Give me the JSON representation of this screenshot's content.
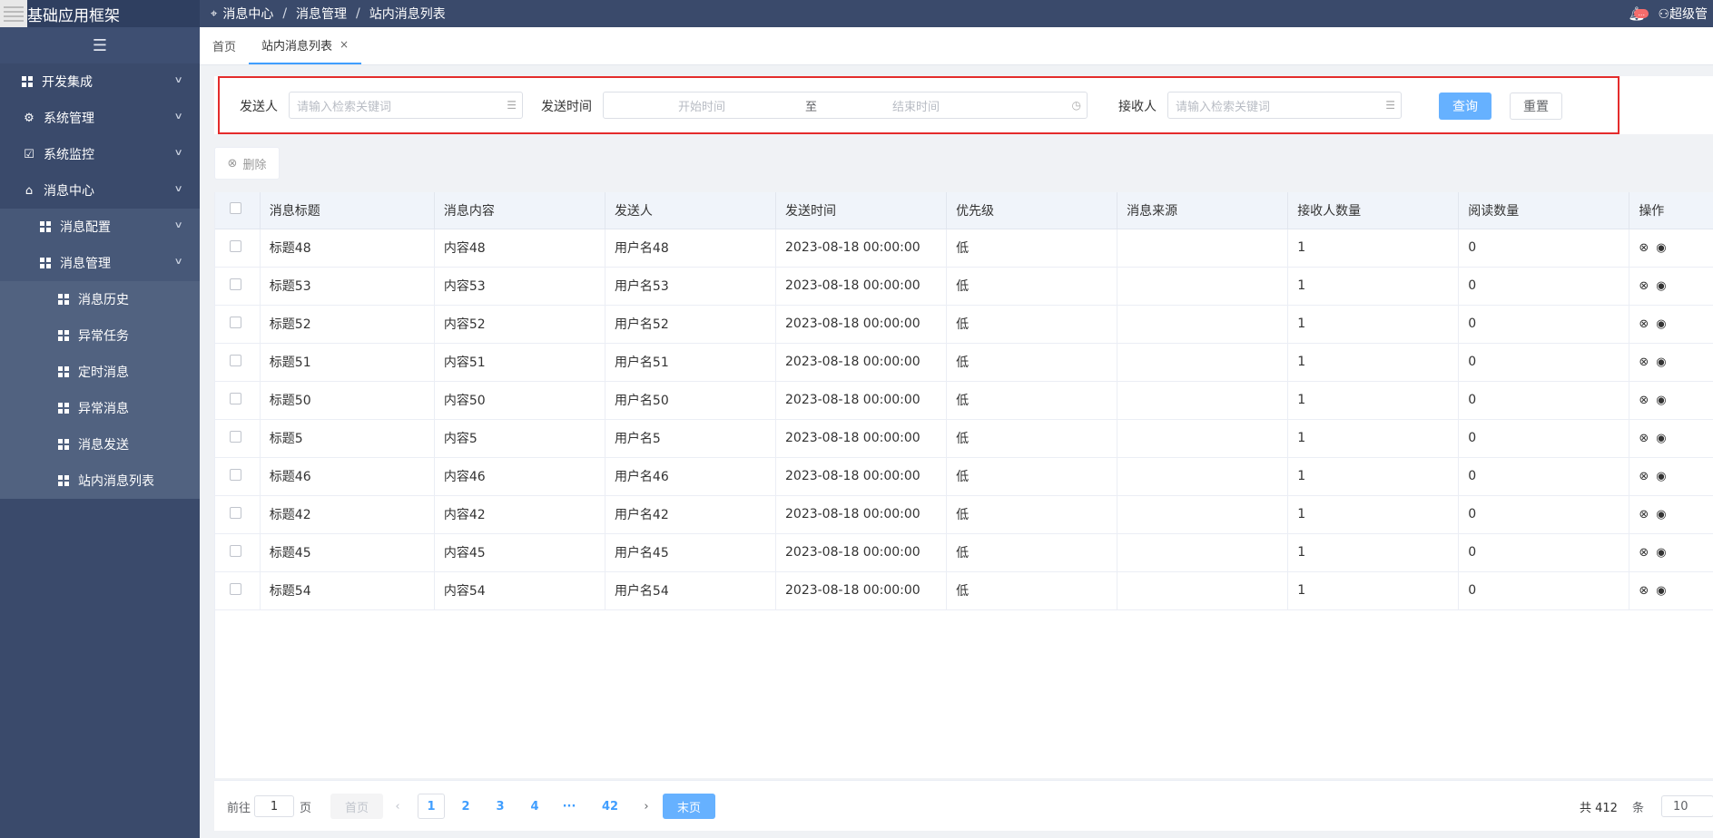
{
  "app": {
    "title": "基础应用框架"
  },
  "sidebar": {
    "items": [
      {
        "label": "开发集成"
      },
      {
        "label": "系统管理"
      },
      {
        "label": "系统监控"
      },
      {
        "label": "消息中心"
      },
      {
        "label": "消息配置"
      },
      {
        "label": "消息管理"
      },
      {
        "label": "消息历史"
      },
      {
        "label": "异常任务"
      },
      {
        "label": "定时消息"
      },
      {
        "label": "异常消息"
      },
      {
        "label": "消息发送"
      },
      {
        "label": "站内消息列表"
      }
    ]
  },
  "header": {
    "breadcrumb": [
      "消息中心",
      "消息管理",
      "站内消息列表"
    ],
    "notify_badge": "...",
    "user": "超级管"
  },
  "tabs": [
    {
      "label": "首页"
    },
    {
      "label": "站内消息列表",
      "close": "×"
    }
  ],
  "search": {
    "sender_label": "发送人",
    "sender_placeholder": "请输入检索关键词",
    "time_label": "发送时间",
    "start_placeholder": "开始时间",
    "to": "至",
    "end_placeholder": "结束时间",
    "receiver_label": "接收人",
    "receiver_placeholder": "请输入检索关键词",
    "query": "查询",
    "reset": "重置"
  },
  "toolbar": {
    "delete": "删除"
  },
  "table": {
    "columns": [
      "消息标题",
      "消息内容",
      "发送人",
      "发送时间",
      "优先级",
      "消息来源",
      "接收人数量",
      "阅读数量",
      "操作"
    ],
    "rows": [
      [
        "标题48",
        "内容48",
        "用户名48",
        "2023-08-18 00:00:00",
        "低",
        "",
        "1",
        "0"
      ],
      [
        "标题53",
        "内容53",
        "用户名53",
        "2023-08-18 00:00:00",
        "低",
        "",
        "1",
        "0"
      ],
      [
        "标题52",
        "内容52",
        "用户名52",
        "2023-08-18 00:00:00",
        "低",
        "",
        "1",
        "0"
      ],
      [
        "标题51",
        "内容51",
        "用户名51",
        "2023-08-18 00:00:00",
        "低",
        "",
        "1",
        "0"
      ],
      [
        "标题50",
        "内容50",
        "用户名50",
        "2023-08-18 00:00:00",
        "低",
        "",
        "1",
        "0"
      ],
      [
        "标题5",
        "内容5",
        "用户名5",
        "2023-08-18 00:00:00",
        "低",
        "",
        "1",
        "0"
      ],
      [
        "标题46",
        "内容46",
        "用户名46",
        "2023-08-18 00:00:00",
        "低",
        "",
        "1",
        "0"
      ],
      [
        "标题42",
        "内容42",
        "用户名42",
        "2023-08-18 00:00:00",
        "低",
        "",
        "1",
        "0"
      ],
      [
        "标题45",
        "内容45",
        "用户名45",
        "2023-08-18 00:00:00",
        "低",
        "",
        "1",
        "0"
      ],
      [
        "标题54",
        "内容54",
        "用户名54",
        "2023-08-18 00:00:00",
        "低",
        "",
        "1",
        "0"
      ]
    ]
  },
  "pagination": {
    "goto_prefix": "前往",
    "goto_value": "1",
    "goto_suffix": "页",
    "first": "首页",
    "prev": "‹",
    "pages": [
      "1",
      "2",
      "3",
      "4",
      "···",
      "42"
    ],
    "next": "›",
    "last": "末页",
    "total": "共 412",
    "total_unit": "条",
    "page_size": "10"
  },
  "colors": {
    "sidebar_bg": "#3a4a6b",
    "primary": "#409eff",
    "highlight_border": "#e42c2c"
  }
}
